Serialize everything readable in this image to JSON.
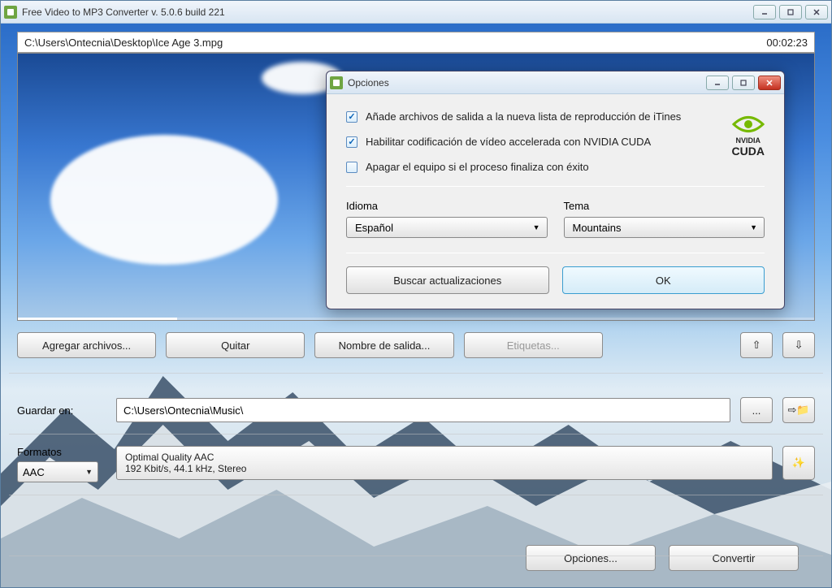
{
  "window": {
    "title": "Free Video to MP3 Converter  v. 5.0.6 build 221"
  },
  "preview": {
    "filepath": "C:\\Users\\Ontecnia\\Desktop\\Ice Age 3.mpg",
    "duration": "00:02:23"
  },
  "toolbar": {
    "add_files": "Agregar archivos...",
    "remove": "Quitar",
    "output_name": "Nombre de salida...",
    "tags": "Etiquetas..."
  },
  "save": {
    "label": "Guardar en:",
    "path": "C:\\Users\\Ontecnia\\Music\\"
  },
  "formats": {
    "label": "Formatos",
    "format_value": "AAC",
    "quality_line1": "Optimal Quality AAC",
    "quality_line2": "192 Kbit/s, 44.1 kHz, Stereo"
  },
  "bottom": {
    "options": "Opciones...",
    "convert": "Convertir"
  },
  "dialog": {
    "title": "Opciones",
    "opt_itunes": "Añade archivos de salida a la nueva lista de reproducción de iTines",
    "opt_cuda": "Habilitar codificación de vídeo accelerada con NVIDIA CUDA",
    "opt_shutdown": "Apagar el equipo si el proceso finaliza con éxito",
    "cuda_brand": "CUDA",
    "cuda_vendor": "NVIDIA",
    "lang_label": "Idioma",
    "lang_value": "Español",
    "theme_label": "Tema",
    "theme_value": "Mountains",
    "btn_updates": "Buscar actualizaciones",
    "btn_ok": "OK"
  }
}
